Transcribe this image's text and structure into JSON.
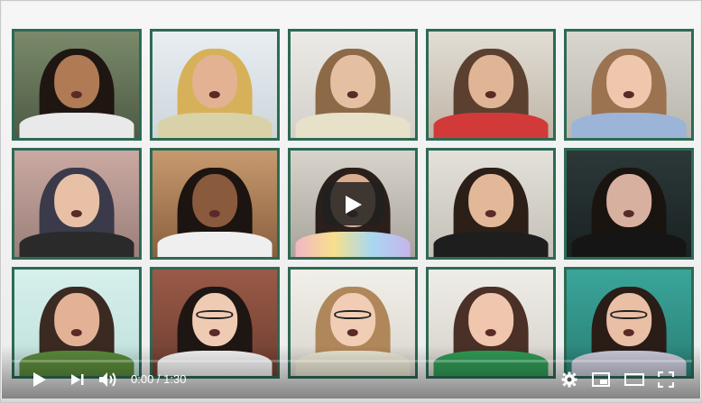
{
  "player": {
    "time_display": "0:00 / 1:30",
    "progress": 0.0
  },
  "colors": {
    "tile_border": "#2d6a54",
    "control_icons": "#ffffff",
    "play_button_bg": "#212121"
  },
  "icons": {
    "big_play": "play-icon",
    "play": "play-icon",
    "next": "next-icon",
    "volume": "volume-icon",
    "settings": "gear-icon",
    "miniplayer": "miniplayer-icon",
    "theater": "theater-mode-icon",
    "fullscreen": "fullscreen-icon"
  }
}
